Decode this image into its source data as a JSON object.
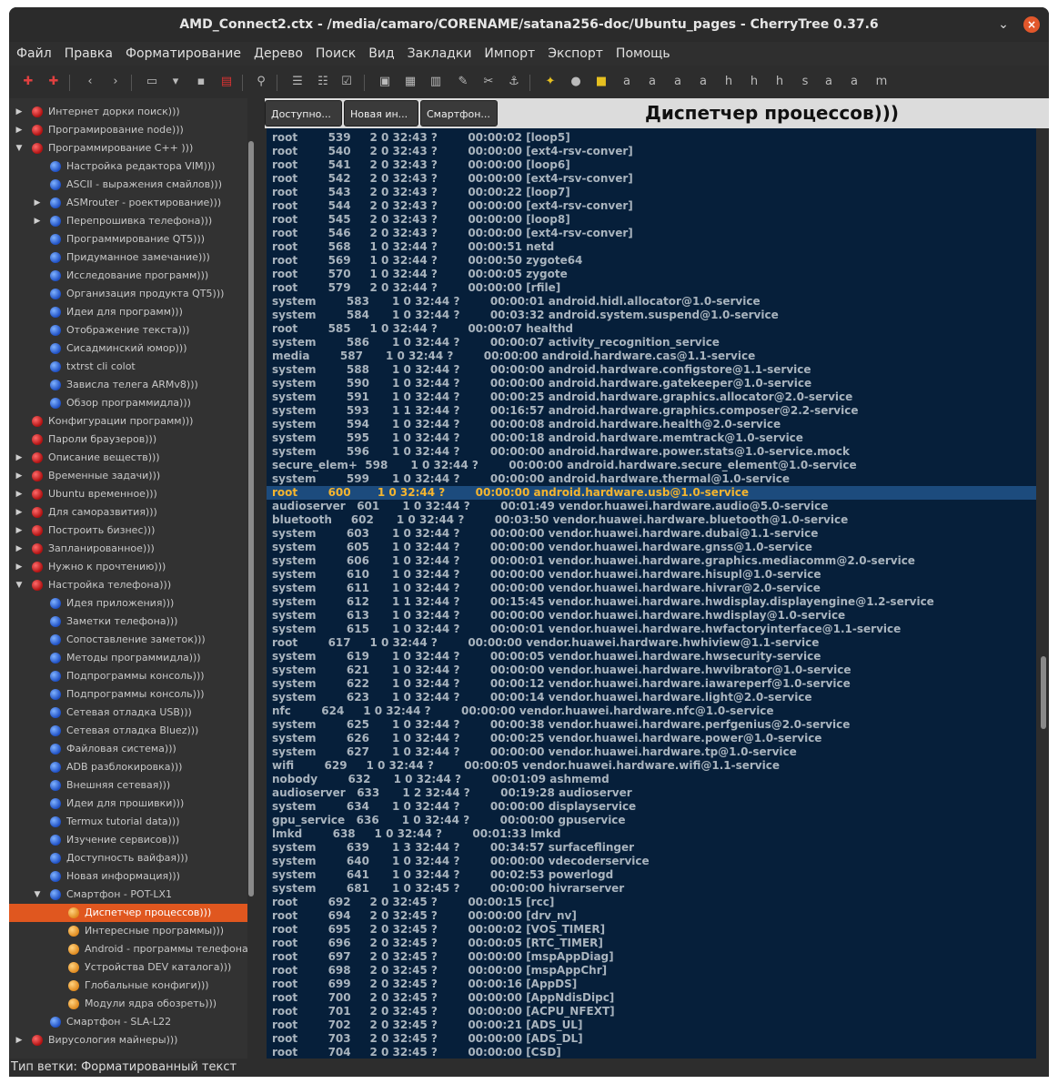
{
  "window": {
    "title": "AMD_Connect2.ctx - /media/camaro/CORENAME/satana256-doc/Ubuntu_pages - CherryTree 0.37.6",
    "chevron_icon": "chevron-down-icon",
    "close_icon": "close-icon"
  },
  "menubar": [
    "Файл",
    "Правка",
    "Форматирование",
    "Дерево",
    "Поиск",
    "Вид",
    "Закладки",
    "Импорт",
    "Экспорт",
    "Помощь"
  ],
  "toolbar": {
    "icons": [
      "add-node-icon",
      "add-subnode-icon",
      "back-icon",
      "forward-icon",
      "open-icon",
      "dropdown-icon",
      "save-icon",
      "export-pdf-icon",
      "find-icon",
      "bulleted-list-icon",
      "numbered-list-icon",
      "todo-list-icon",
      "insert-image-icon",
      "insert-table-icon",
      "insert-codebox-icon",
      "attach-file-icon",
      "insert-link-icon",
      "insert-anchor-icon",
      "clear-format-icon",
      "color-foreground-icon",
      "color-background-icon",
      "bold-icon",
      "italic-icon",
      "underline-icon",
      "strikethrough-icon",
      "h1-icon",
      "h2-icon",
      "h3-icon",
      "small-icon",
      "superscript-icon",
      "subscript-icon",
      "monospace-icon"
    ]
  },
  "tree": {
    "items": [
      {
        "label": "Интернет дорки поиск)))",
        "depth": 0,
        "color": "red",
        "arrow": "right"
      },
      {
        "label": "Програмирование node)))",
        "depth": 0,
        "color": "red",
        "arrow": "right"
      },
      {
        "label": "Программирование С++ )))",
        "depth": 0,
        "color": "red",
        "arrow": "down"
      },
      {
        "label": "Настройка редактора VIM)))",
        "depth": 1,
        "color": "blue",
        "arrow": ""
      },
      {
        "label": "ASCII - выражения смайлов)))",
        "depth": 1,
        "color": "blue",
        "arrow": ""
      },
      {
        "label": "ASMrouter - роектирование)))",
        "depth": 1,
        "color": "blue",
        "arrow": "right"
      },
      {
        "label": "Перепрошивка телефона)))",
        "depth": 1,
        "color": "blue",
        "arrow": "right"
      },
      {
        "label": "Программирование QT5)))",
        "depth": 1,
        "color": "blue",
        "arrow": ""
      },
      {
        "label": "Придуманное замечание)))",
        "depth": 1,
        "color": "blue",
        "arrow": ""
      },
      {
        "label": "Исследование программ)))",
        "depth": 1,
        "color": "blue",
        "arrow": ""
      },
      {
        "label": "Организация продукта QT5)))",
        "depth": 1,
        "color": "blue",
        "arrow": ""
      },
      {
        "label": "Идеи для программ)))",
        "depth": 1,
        "color": "blue",
        "arrow": ""
      },
      {
        "label": "Отображение текста)))",
        "depth": 1,
        "color": "blue",
        "arrow": ""
      },
      {
        "label": "Сисадминский юмор)))",
        "depth": 1,
        "color": "blue",
        "arrow": ""
      },
      {
        "label": "txtrst cli colot",
        "depth": 1,
        "color": "blue",
        "arrow": ""
      },
      {
        "label": "Зависла телега ARMv8)))",
        "depth": 1,
        "color": "blue",
        "arrow": ""
      },
      {
        "label": "Обзор программидла)))",
        "depth": 1,
        "color": "blue",
        "arrow": ""
      },
      {
        "label": "Конфигурации программ)))",
        "depth": 0,
        "color": "red",
        "arrow": ""
      },
      {
        "label": "Пароли браузеров)))",
        "depth": 0,
        "color": "red",
        "arrow": ""
      },
      {
        "label": "Описание веществ)))",
        "depth": 0,
        "color": "red",
        "arrow": "right"
      },
      {
        "label": "Временные задачи)))",
        "depth": 0,
        "color": "red",
        "arrow": "right"
      },
      {
        "label": "Ubuntu временное)))",
        "depth": 0,
        "color": "red",
        "arrow": "right"
      },
      {
        "label": "Для саморазвития)))",
        "depth": 0,
        "color": "red",
        "arrow": "right"
      },
      {
        "label": "Построить бизнес)))",
        "depth": 0,
        "color": "red",
        "arrow": "right"
      },
      {
        "label": "Запланированное)))",
        "depth": 0,
        "color": "red",
        "arrow": "right"
      },
      {
        "label": "Нужно к прочтению)))",
        "depth": 0,
        "color": "red",
        "arrow": "right"
      },
      {
        "label": "Настройка телефона)))",
        "depth": 0,
        "color": "red",
        "arrow": "down"
      },
      {
        "label": "Идея приложения)))",
        "depth": 1,
        "color": "blue",
        "arrow": ""
      },
      {
        "label": "Заметки телефона)))",
        "depth": 1,
        "color": "blue",
        "arrow": ""
      },
      {
        "label": "Сопоставление заметок)))",
        "depth": 1,
        "color": "blue",
        "arrow": ""
      },
      {
        "label": "Методы программидла)))",
        "depth": 1,
        "color": "blue",
        "arrow": ""
      },
      {
        "label": "Подпрограммы консоль)))",
        "depth": 1,
        "color": "blue",
        "arrow": ""
      },
      {
        "label": "Подпрограммы консоль)))",
        "depth": 1,
        "color": "blue",
        "arrow": ""
      },
      {
        "label": "Сетевая отладка USB)))",
        "depth": 1,
        "color": "blue",
        "arrow": ""
      },
      {
        "label": "Сетевая отладка Bluez)))",
        "depth": 1,
        "color": "blue",
        "arrow": ""
      },
      {
        "label": "Файловая система)))",
        "depth": 1,
        "color": "blue",
        "arrow": ""
      },
      {
        "label": "ADB разблокировка)))",
        "depth": 1,
        "color": "blue",
        "arrow": ""
      },
      {
        "label": "Внешняя сетевая)))",
        "depth": 1,
        "color": "blue",
        "arrow": ""
      },
      {
        "label": "Идеи для прошивки)))",
        "depth": 1,
        "color": "blue",
        "arrow": ""
      },
      {
        "label": "Termux tutorial data)))",
        "depth": 1,
        "color": "blue",
        "arrow": ""
      },
      {
        "label": "Изучение сервисов)))",
        "depth": 1,
        "color": "blue",
        "arrow": ""
      },
      {
        "label": "Доступность вайфая)))",
        "depth": 1,
        "color": "blue",
        "arrow": ""
      },
      {
        "label": "Новая информация)))",
        "depth": 1,
        "color": "blue",
        "arrow": ""
      },
      {
        "label": "Смартфон  - POT-LX1",
        "depth": 1,
        "color": "blue",
        "arrow": "down"
      },
      {
        "label": "Диспетчер процессов)))",
        "depth": 2,
        "color": "orange",
        "arrow": "",
        "selected": true
      },
      {
        "label": "Интересные программы)))",
        "depth": 2,
        "color": "orange",
        "arrow": ""
      },
      {
        "label": "Android - программы телефона",
        "depth": 2,
        "color": "orange",
        "arrow": ""
      },
      {
        "label": "Устройства DEV каталога)))",
        "depth": 2,
        "color": "orange",
        "arrow": ""
      },
      {
        "label": "Глобальные конфиги)))",
        "depth": 2,
        "color": "orange",
        "arrow": ""
      },
      {
        "label": "Модули ядра обозреть)))",
        "depth": 2,
        "color": "orange",
        "arrow": ""
      },
      {
        "label": "Смартфон - SLA-L22",
        "depth": 1,
        "color": "blue",
        "arrow": ""
      },
      {
        "label": "Вирусология майнеры)))",
        "depth": 0,
        "color": "red",
        "arrow": "right"
      }
    ]
  },
  "tabs": [
    "Доступно...",
    "Новая ин...",
    "Смартфон..."
  ],
  "node_title": "Диспетчер процессов)))",
  "editor": {
    "highlighted_index": 26,
    "lines": [
      "root        539     2 0 32:43 ?        00:00:02 [loop5]",
      "root        540     2 0 32:43 ?        00:00:00 [ext4-rsv-conver]",
      "root        541     2 0 32:43 ?        00:00:00 [loop6]",
      "root        542     2 0 32:43 ?        00:00:00 [ext4-rsv-conver]",
      "root        543     2 0 32:43 ?        00:00:22 [loop7]",
      "root        544     2 0 32:43 ?        00:00:00 [ext4-rsv-conver]",
      "root        545     2 0 32:43 ?        00:00:00 [loop8]",
      "root        546     2 0 32:43 ?        00:00:00 [ext4-rsv-conver]",
      "root        568     1 0 32:44 ?        00:00:51 netd",
      "root        569     1 0 32:44 ?        00:00:50 zygote64",
      "root        570     1 0 32:44 ?        00:00:05 zygote",
      "root        579     2 0 32:44 ?        00:00:00 [rfile]",
      "system        583      1 0 32:44 ?        00:00:01 android.hidl.allocator@1.0-service",
      "system        584      1 0 32:44 ?        00:03:32 android.system.suspend@1.0-service",
      "root        585     1 0 32:44 ?        00:00:07 healthd",
      "system        586      1 0 32:44 ?        00:00:07 activity_recognition_service",
      "media        587      1 0 32:44 ?        00:00:00 android.hardware.cas@1.1-service",
      "system        588      1 0 32:44 ?        00:00:00 android.hardware.configstore@1.1-service",
      "system        590      1 0 32:44 ?        00:00:00 android.hardware.gatekeeper@1.0-service",
      "system        591      1 0 32:44 ?        00:00:25 android.hardware.graphics.allocator@2.0-service",
      "system        593      1 1 32:44 ?        00:16:57 android.hardware.graphics.composer@2.2-service",
      "system        594      1 0 32:44 ?        00:00:08 android.hardware.health@2.0-service",
      "system        595      1 0 32:44 ?        00:00:18 android.hardware.memtrack@1.0-service",
      "system        596      1 0 32:44 ?        00:00:00 android.hardware.power.stats@1.0-service.mock",
      "secure_elem+  598      1 0 32:44 ?        00:00:00 android.hardware.secure_element@1.0-service",
      "system        599      1 0 32:44 ?        00:00:00 android.hardware.thermal@1.0-service",
      "root        600       1 0 32:44 ?        00:00:00 android.hardware.usb@1.0-service",
      "audioserver   601      1 0 32:44 ?        00:01:49 vendor.huawei.hardware.audio@5.0-service",
      "bluetooth     602      1 0 32:44 ?        00:03:50 vendor.huawei.hardware.bluetooth@1.0-service",
      "system        603      1 0 32:44 ?        00:00:00 vendor.huawei.hardware.dubai@1.1-service",
      "system        605      1 0 32:44 ?        00:00:00 vendor.huawei.hardware.gnss@1.0-service",
      "system        606      1 0 32:44 ?        00:00:01 vendor.huawei.hardware.graphics.mediacomm@2.0-service",
      "system        610      1 0 32:44 ?        00:00:00 vendor.huawei.hardware.hisupl@1.0-service",
      "system        611      1 0 32:44 ?        00:00:00 vendor.huawei.hardware.hivrar@2.0-service",
      "system        612      1 1 32:44 ?        00:15:45 vendor.huawei.hardware.hwdisplay.displayengine@1.2-service",
      "system        613      1 0 32:44 ?        00:00:00 vendor.huawei.hardware.hwdisplay@1.0-service",
      "system        615      1 0 32:44 ?        00:00:01 vendor.huawei.hardware.hwfactoryinterface@1.1-service",
      "root        617     1 0 32:44 ?        00:00:00 vendor.huawei.hardware.hwhiview@1.1-service",
      "system        619      1 0 32:44 ?        00:00:05 vendor.huawei.hardware.hwsecurity-service",
      "system        621      1 0 32:44 ?        00:00:00 vendor.huawei.hardware.hwvibrator@1.0-service",
      "system        622      1 0 32:44 ?        00:00:12 vendor.huawei.hardware.iawareperf@1.0-service",
      "system        623      1 0 32:44 ?        00:00:14 vendor.huawei.hardware.light@2.0-service",
      "nfc        624     1 0 32:44 ?        00:00:00 vendor.huawei.hardware.nfc@1.0-service",
      "system        625      1 0 32:44 ?        00:00:38 vendor.huawei.hardware.perfgenius@2.0-service",
      "system        626      1 0 32:44 ?        00:00:25 vendor.huawei.hardware.power@1.0-service",
      "system        627      1 0 32:44 ?        00:00:00 vendor.huawei.hardware.tp@1.0-service",
      "wifi        629     1 0 32:44 ?        00:00:05 vendor.huawei.hardware.wifi@1.1-service",
      "nobody        632      1 0 32:44 ?        00:01:09 ashmemd",
      "audioserver   633      1 2 32:44 ?        00:19:28 audioserver",
      "system        634      1 0 32:44 ?        00:00:00 displayservice",
      "gpu_service   636      1 0 32:44 ?        00:00:00 gpuservice",
      "lmkd        638     1 0 32:44 ?        00:01:33 lmkd",
      "system        639      1 3 32:44 ?        00:34:57 surfaceflinger",
      "system        640      1 0 32:44 ?        00:00:00 vdecoderservice",
      "system        641      1 0 32:44 ?        00:02:53 powerlogd",
      "system        681      1 0 32:45 ?        00:00:00 hivrarserver",
      "root        692     2 0 32:45 ?        00:00:15 [rcc]",
      "root        694     2 0 32:45 ?        00:00:00 [drv_nv]",
      "root        695     2 0 32:45 ?        00:00:02 [VOS_TIMER]",
      "root        696     2 0 32:45 ?        00:00:05 [RTC_TIMER]",
      "root        697     2 0 32:45 ?        00:00:00 [mspAppDiag]",
      "root        698     2 0 32:45 ?        00:00:00 [mspAppChr]",
      "root        699     2 0 32:45 ?        00:00:16 [AppDS]",
      "root        700     2 0 32:45 ?        00:00:00 [AppNdisDipc]",
      "root        701     2 0 32:45 ?        00:00:00 [ACPU_NFEXT]",
      "root        702     2 0 32:45 ?        00:00:21 [ADS_UL]",
      "root        703     2 0 32:45 ?        00:00:00 [ADS_DL]",
      "root        704     2 0 32:45 ?        00:00:00 [CSD]"
    ]
  },
  "statusbar": "Тип ветки: Форматированный текст",
  "colors": {
    "selection": "#e0571f",
    "editor_bg": "#061f3a",
    "highlight_text": "#f4b52f",
    "highlight_bg": "#1c4b7d"
  }
}
